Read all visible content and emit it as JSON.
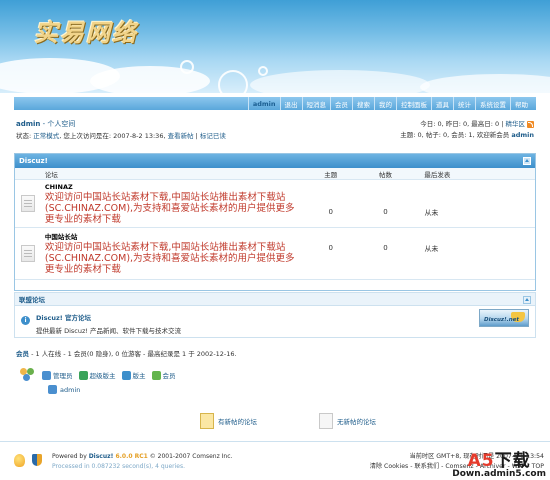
{
  "header": {
    "logo_text": "实易网络"
  },
  "nav": {
    "items": [
      "admin",
      "退出",
      "短消息",
      "会员",
      "搜索",
      "我的",
      "控制面板",
      "道具",
      "统计",
      "系统设置",
      "帮助"
    ]
  },
  "breadcrumb": {
    "user": "admin",
    "sep": " - ",
    "space": "个人空间"
  },
  "status": {
    "prefix": "状态: ",
    "mode": "正常模式",
    "last_visit": ", 您上次访问是在: 2007-8-2 13:36, ",
    "view_new": "查看新帖",
    "mark_read": "标记已读"
  },
  "stats": {
    "line1_left": "今日: 0, 昨日: 0, 最高日: 0",
    "line1_sep": " | ",
    "digest": "精华区",
    "line2": "主题: 0, 帖子: 0, 会员: 1, 欢迎新会员 ",
    "newest_member": "admin"
  },
  "forum_box": {
    "category": "Discuz!",
    "columns": {
      "forum": "论坛",
      "topics": "主题",
      "posts": "帖数",
      "last": "最后发表"
    },
    "forums": [
      {
        "name": "CHINAZ",
        "desc": "欢迎访问中国站长站素材下载,中国站长站推出素材下载站(SC.CHINAZ.COM),为支持和喜爱站长素材的用户提供更多更专业的素材下载",
        "topics": "0",
        "posts": "0",
        "last": "从未"
      },
      {
        "name": "中国站长站",
        "desc": "欢迎访问中国站长站素材下载,中国站长站推出素材下载站(SC.CHINAZ.COM),为支持和喜爱站长素材的用户提供更多更专业的素材下载",
        "topics": "0",
        "posts": "0",
        "last": "从未"
      }
    ]
  },
  "ally": {
    "title": "联盟论坛",
    "name": "Discuz! 官方论坛",
    "desc": "提供最新 Discuz! 产品新闻、软件下载与技术交流",
    "badge": "Discuz!.net"
  },
  "members": {
    "label": "会员",
    "summary": " - 1 人在线 - 1 会员(0 隐身), 0 位游客 - 最高纪录是 1 于 2002-12-16.",
    "groups": [
      {
        "label": "管理员",
        "color": "#4a8fcf"
      },
      {
        "label": "超级版主",
        "color": "#3aa35a"
      },
      {
        "label": "版主",
        "color": "#3d8fcb"
      },
      {
        "label": "会员",
        "color": "#63b54d"
      }
    ],
    "online_user": "admin"
  },
  "legend": {
    "new": "有新帖的论坛",
    "none": "无新帖的论坛"
  },
  "footer": {
    "powered_by": "Powered by ",
    "brand": "Discuz!",
    "version": " 6.0.0 RC1",
    "copyright": " © 2001-2007 Comsenz Inc.",
    "processed": "Processed in 0.087232 second(s), 4 queries.",
    "time_label": "当前时区 GMT+8, 现在时间是 2007-8-8 13:54",
    "links": "清除 Cookies - 联系我们 - Comsenz - Archiver - WAP - TOP"
  },
  "watermark": {
    "logo_a": "A5",
    "logo_b": "下载",
    "domain": "Down.admin5.com"
  }
}
